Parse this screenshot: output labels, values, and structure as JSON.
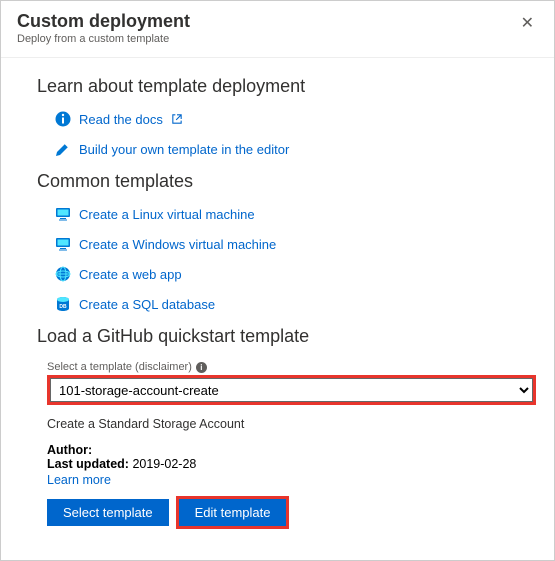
{
  "header": {
    "title": "Custom deployment",
    "subtitle": "Deploy from a custom template",
    "close_label": "✕"
  },
  "learn": {
    "heading": "Learn about template deployment",
    "docs_label": "Read the docs",
    "build_label": "Build your own template in the editor"
  },
  "common": {
    "heading": "Common templates",
    "linux_label": "Create a Linux virtual machine",
    "windows_label": "Create a Windows virtual machine",
    "webapp_label": "Create a web app",
    "sql_label": "Create a SQL database"
  },
  "github": {
    "heading": "Load a GitHub quickstart template",
    "select_label": "Select a template (disclaimer)",
    "selected_value": "101-storage-account-create",
    "description": "Create a Standard Storage Account",
    "author_label": "Author:",
    "updated_label": "Last updated:",
    "updated_value": "2019-02-28",
    "learn_more": "Learn more",
    "select_btn": "Select template",
    "edit_btn": "Edit template"
  }
}
